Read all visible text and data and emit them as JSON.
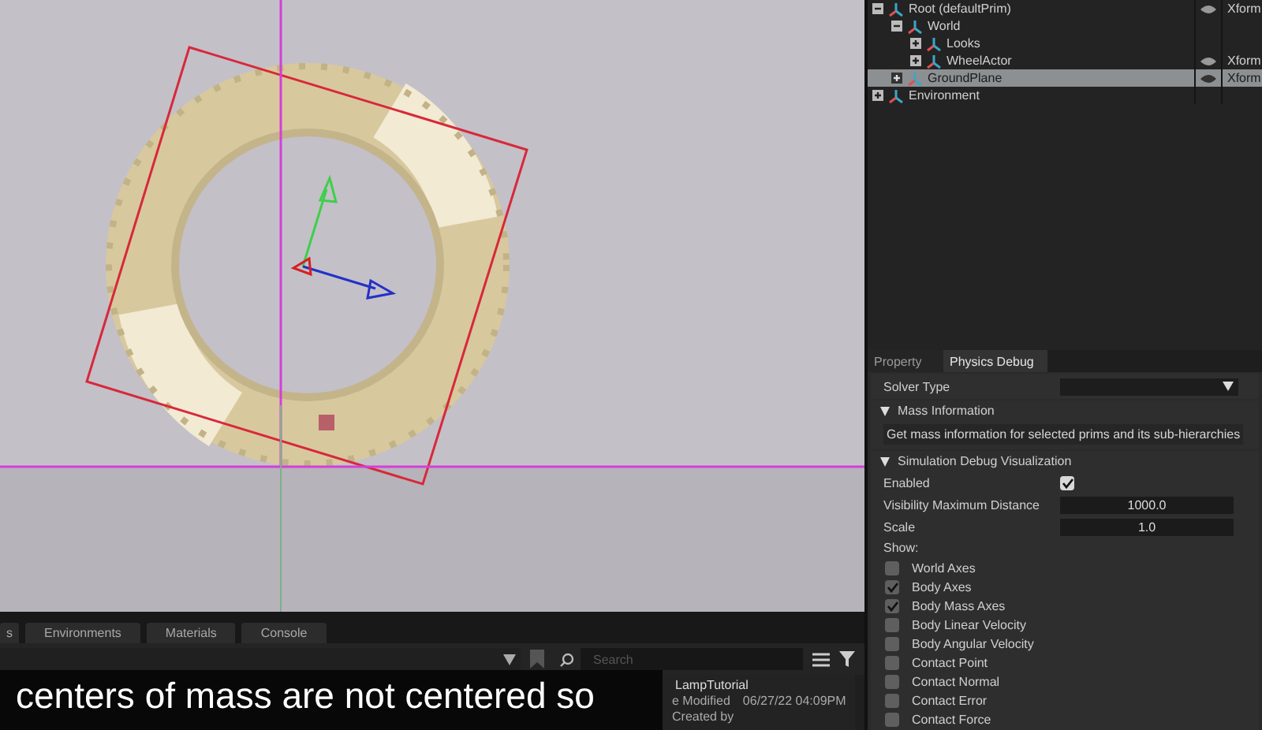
{
  "stage_tree": {
    "items": [
      {
        "label": "Root (defaultPrim)",
        "expanded": true,
        "selected": false,
        "visible": true,
        "type": "Xform",
        "children": [
          {
            "label": "World",
            "expanded": true,
            "selected": false,
            "children": [
              {
                "label": "Looks",
                "expanded": false,
                "selected": false
              },
              {
                "label": "WheelActor",
                "expanded": false,
                "selected": false,
                "visible": true,
                "type": "Xform"
              }
            ]
          },
          {
            "label": "GroundPlane",
            "expanded": false,
            "selected": true,
            "visible": true,
            "type": "Xform"
          }
        ]
      },
      {
        "label": "Environment",
        "expanded": false,
        "selected": false
      }
    ]
  },
  "property_panel": {
    "tabs": [
      {
        "label": "Property",
        "selected": false
      },
      {
        "label": "Physics Debug",
        "selected": true
      }
    ],
    "solver_type": {
      "label": "Solver Type"
    },
    "mass_information": {
      "title": "Mass Information",
      "expanded": true,
      "button": "Get mass information for selected prims and its sub-hierarchies"
    },
    "simulation_debug": {
      "title": "Simulation Debug Visualization",
      "expanded": true,
      "enabled": {
        "label": "Enabled",
        "checked": true
      },
      "fields": [
        {
          "label": "Visibility Maximum Distance",
          "value": "1000.0"
        },
        {
          "label": "Scale",
          "value": "1.0"
        }
      ],
      "show_label": "Show:",
      "options": [
        {
          "label": "World Axes",
          "checked": false
        },
        {
          "label": "Body Axes",
          "checked": true
        },
        {
          "label": "Body Mass Axes",
          "checked": true
        },
        {
          "label": "Body Linear Velocity",
          "checked": false
        },
        {
          "label": "Body Angular Velocity",
          "checked": false
        },
        {
          "label": "Contact Point",
          "checked": false
        },
        {
          "label": "Contact Normal",
          "checked": false
        },
        {
          "label": "Contact Error",
          "checked": false
        },
        {
          "label": "Contact Force",
          "checked": false
        }
      ]
    }
  },
  "content_browser": {
    "tabs": [
      {
        "label": "s",
        "selected": false
      },
      {
        "label": "Environments",
        "selected": false
      },
      {
        "label": "Materials",
        "selected": false
      },
      {
        "label": "Console",
        "selected": false
      }
    ],
    "search": {
      "placeholder": "Search"
    },
    "details": {
      "name": "LampTutorial",
      "rows": [
        {
          "label": "e Modified",
          "value": "06/27/22 04:09PM"
        },
        {
          "label": "Created by"
        }
      ]
    }
  },
  "subtitle": "centers of mass are not centered so"
}
